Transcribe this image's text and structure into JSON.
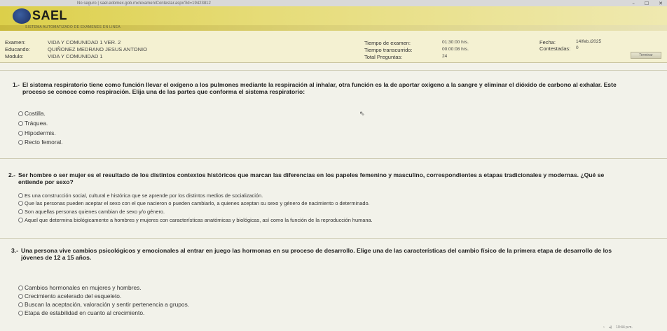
{
  "browser": {
    "url": "No seguro  |  sael.edomex.gob.mx/examen/Contestar.aspx?id=19423812",
    "ctrl_min": "–",
    "ctrl_max": "☐",
    "ctrl_close": "✕"
  },
  "header": {
    "app_title": "SAEL",
    "subtitle": "SISTEMA AUTOMATIZADO DE EXAMENES EN LINEA",
    "brand_color": "#dccf4a"
  },
  "exam_info": {
    "examen_label": "Examen:",
    "examen_value": "VIDA Y COMUNIDAD 1 VER. 2",
    "educando_label": "Educando:",
    "educando_value": "QUIÑONEZ MEDRANO JESUS ANTONIO",
    "modulo_label": "Modulo:",
    "modulo_value": "VIDA Y COMUNIDAD 1",
    "tiempo_examen_label": "Tiempo de examen:",
    "tiempo_examen_value": "01:30:00 hrs.",
    "tiempo_transcurrido_label": "Tiempo transcurrido:",
    "tiempo_transcurrido_value": "00:00:08 hrs.",
    "total_preguntas_label": "Total Preguntas:",
    "total_preguntas_value": "24",
    "fecha_label": "Fecha:",
    "fecha_value": "14/feb./2025",
    "contestadas_label": "Contestadas:",
    "contestadas_value": "0",
    "terminar_label": "Terminar"
  },
  "questions": [
    {
      "number": "1.-",
      "text_line1": "El sistema respiratorio tiene como función llevar el oxígeno a los pulmones mediante la respiración al inhalar, otra función es la de aportar oxígeno a la sangre y eliminar el dióxido de carbono al exhalar. Este",
      "text_line2": "proceso se conoce como respiración. Elija una de las partes que conforma el sistema respiratorio:",
      "options": [
        "Costilla.",
        "Tráquea.",
        "Hipodermis.",
        "Recto femoral."
      ]
    },
    {
      "number": "2.-",
      "text_line1": "Ser hombre o ser mujer es el resultado de los distintos contextos históricos que marcan las diferencias en los papeles femenino y masculino, correspondientes a etapas tradicionales y modernas. ¿Qué se",
      "text_line2": "entiende por sexo?",
      "options": [
        "Es una construcción social, cultural e histórica que se aprende por los distintos medios de socialización.",
        "Que las personas pueden aceptar el sexo con el que nacieron o pueden cambiarlo, a quienes aceptan su sexo y género de nacimiento o determinado.",
        "Son aquellas personas quienes cambian de sexo y/o género.",
        "Aquel que determina biológicamente a hombres y mujeres con características anatómicas y biológicas, así como la función de la reproducción humana."
      ]
    },
    {
      "number": "3.-",
      "text_line1": "Una persona vive cambios psicológicos y emocionales al entrar en juego las hormonas en su proceso de desarrollo. Elige una de las características del cambio físico de la primera etapa de desarrollo de los",
      "text_line2": "jóvenes de 12 a 15 años.",
      "options": [
        "Cambios hormonales en mujeres y hombres.",
        "Crecimiento acelerado del esqueleto.",
        "Buscan la aceptación, valoración y sentir pertenencia a grupos.",
        "Etapa de estabilidad en cuanto al crecimiento."
      ]
    }
  ],
  "taskbar": {
    "clock": "10:44 p.m."
  }
}
